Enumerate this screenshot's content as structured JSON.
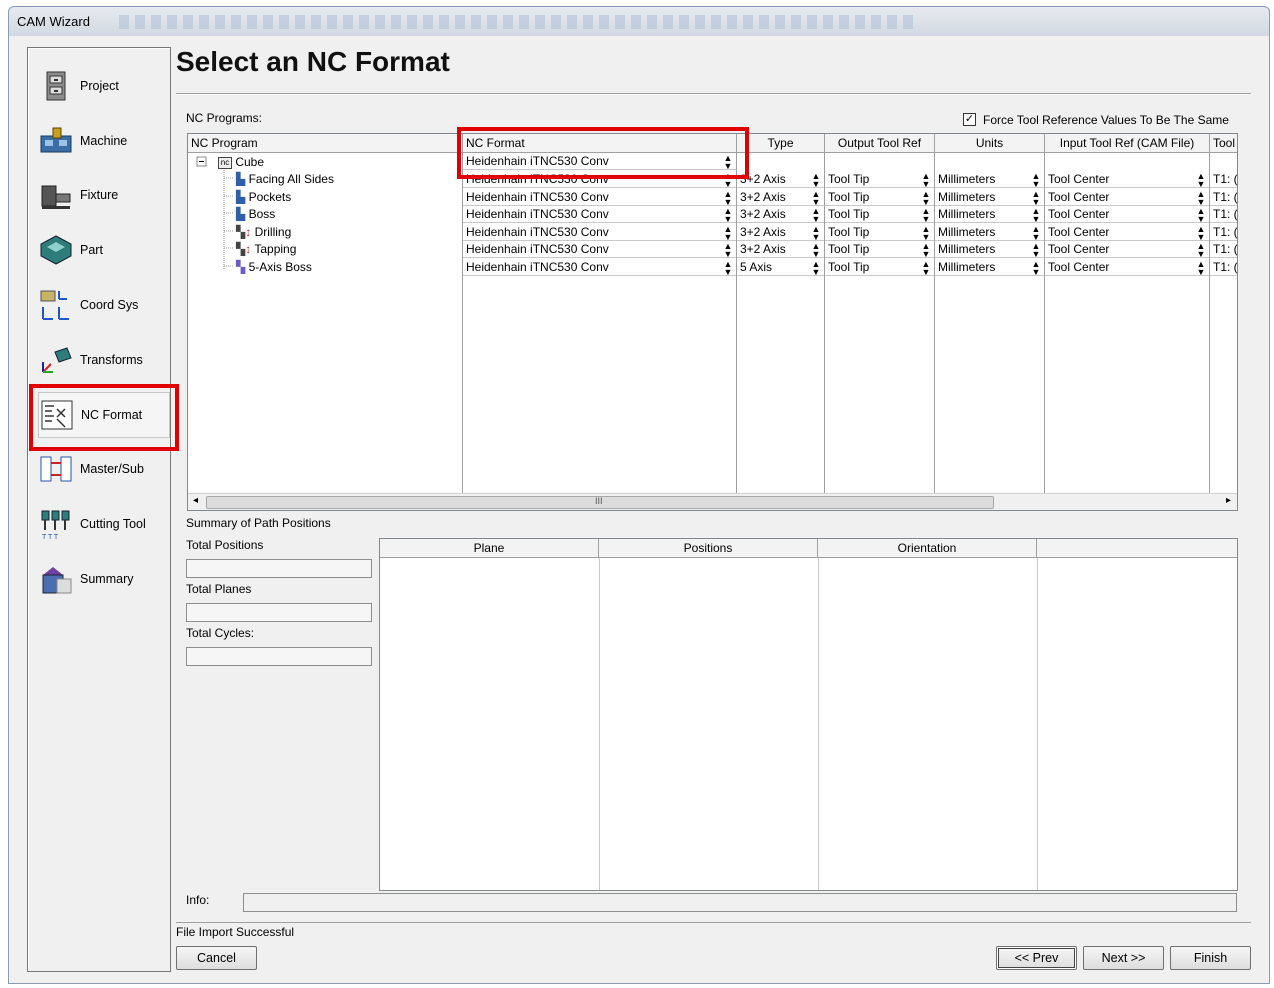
{
  "window": {
    "title": "CAM Wizard"
  },
  "sidebar": {
    "items": [
      {
        "label": "Project",
        "icon": "file-cabinet-icon"
      },
      {
        "label": "Machine",
        "icon": "machine-icon"
      },
      {
        "label": "Fixture",
        "icon": "fixture-icon"
      },
      {
        "label": "Part",
        "icon": "part-icon"
      },
      {
        "label": "Coord Sys",
        "icon": "coord-sys-icon"
      },
      {
        "label": "Transforms",
        "icon": "transforms-icon"
      },
      {
        "label": "NC Format",
        "icon": "nc-format-icon",
        "active": true
      },
      {
        "label": "Master/Sub",
        "icon": "master-sub-icon"
      },
      {
        "label": "Cutting Tool",
        "icon": "cutting-tool-icon"
      },
      {
        "label": "Summary",
        "icon": "summary-icon"
      }
    ]
  },
  "main": {
    "title": "Select an NC Format",
    "nc_programs_label": "NC Programs:",
    "force_checkbox": {
      "label": "Force Tool Reference Values To Be The Same",
      "checked": true
    }
  },
  "grid": {
    "columns": [
      "NC Program",
      "NC Format",
      "Type",
      "Output Tool Ref",
      "Units",
      "Input Tool Ref (CAM File)",
      "Tool"
    ],
    "tree": {
      "root": "Cube",
      "root_badge": "nc",
      "children": [
        "Facing All Sides",
        "Pockets",
        "Boss",
        "Drilling",
        "Tapping",
        "5-Axis Boss"
      ]
    },
    "root_format": "Heidenhain iTNC530 Conv",
    "rows": [
      {
        "format": "Heidenhain iTNC530 Conv",
        "type": "3+2 Axis",
        "output": "Tool Tip",
        "units": "Millimeters",
        "input": "Tool Center",
        "tool": "T1: ("
      },
      {
        "format": "Heidenhain iTNC530 Conv",
        "type": "3+2 Axis",
        "output": "Tool Tip",
        "units": "Millimeters",
        "input": "Tool Center",
        "tool": "T1: ("
      },
      {
        "format": "Heidenhain iTNC530 Conv",
        "type": "3+2 Axis",
        "output": "Tool Tip",
        "units": "Millimeters",
        "input": "Tool Center",
        "tool": "T1: ("
      },
      {
        "format": "Heidenhain iTNC530 Conv",
        "type": "3+2 Axis",
        "output": "Tool Tip",
        "units": "Millimeters",
        "input": "Tool Center",
        "tool": "T1: ("
      },
      {
        "format": "Heidenhain iTNC530 Conv",
        "type": "3+2 Axis",
        "output": "Tool Tip",
        "units": "Millimeters",
        "input": "Tool Center",
        "tool": "T1: ("
      },
      {
        "format": "Heidenhain iTNC530 Conv",
        "type": "5 Axis",
        "output": "Tool Tip",
        "units": "Millimeters",
        "input": "Tool Center",
        "tool": "T1: ("
      }
    ],
    "scroll_grip": "III"
  },
  "summary": {
    "title": "Summary of Path Positions",
    "total_positions_label": "Total Positions",
    "total_planes_label": "Total Planes",
    "total_cycles_label": "Total Cycles:",
    "columns": [
      "Plane",
      "Positions",
      "Orientation",
      ""
    ]
  },
  "info_label": "Info:",
  "status": "File Import Successful",
  "buttons": {
    "cancel": "Cancel",
    "prev": "<< Prev",
    "next": "Next >>",
    "finish": "Finish"
  },
  "colors": {
    "highlight": "#e00000",
    "background": "#f0f0f0"
  }
}
